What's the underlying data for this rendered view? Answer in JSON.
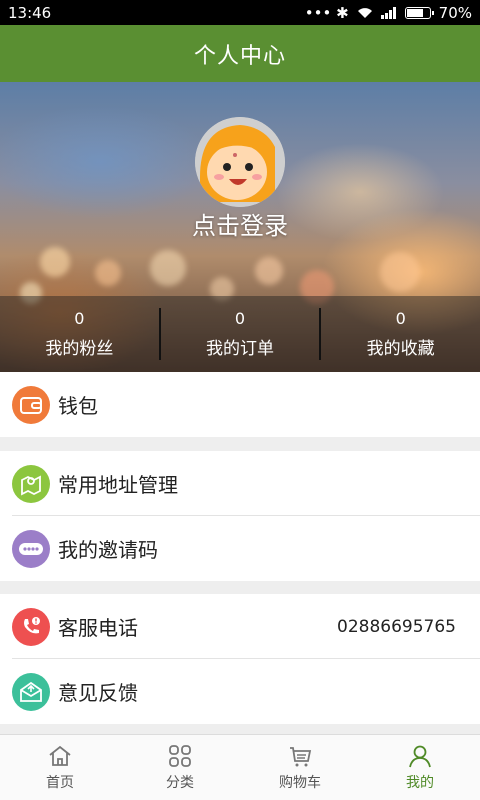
{
  "status_bar": {
    "time": "13:46",
    "signal_icons": "••• ✱ ",
    "battery": "70%",
    "battery_level": 0.7
  },
  "title": "个人中心",
  "profile": {
    "login_label": "点击登录"
  },
  "stats": [
    {
      "value": "0",
      "label": "我的粉丝"
    },
    {
      "value": "0",
      "label": "我的订单"
    },
    {
      "value": "0",
      "label": "我的收藏"
    }
  ],
  "menu": {
    "wallet": {
      "label": "钱包",
      "icon": "wallet-icon",
      "color": "#f07a3a"
    },
    "address": {
      "label": "常用地址管理",
      "icon": "map-pin-icon",
      "color": "#8cc63f"
    },
    "invite": {
      "label": "我的邀请码",
      "icon": "dots-icon",
      "color": "#9b7ec8"
    },
    "service": {
      "label": "客服电话",
      "value": "02886695765",
      "icon": "phone-icon",
      "color": "#ee5050"
    },
    "feedback": {
      "label": "意见反馈",
      "icon": "mail-icon",
      "color": "#3cc09a"
    }
  },
  "nav": [
    {
      "label": "首页",
      "icon": "home-icon"
    },
    {
      "label": "分类",
      "icon": "grid-icon"
    },
    {
      "label": "购物车",
      "icon": "cart-icon"
    },
    {
      "label": "我的",
      "icon": "user-icon",
      "active": true
    }
  ],
  "colors": {
    "brand": "#5a8f32",
    "active_nav": "#4f8a27"
  }
}
